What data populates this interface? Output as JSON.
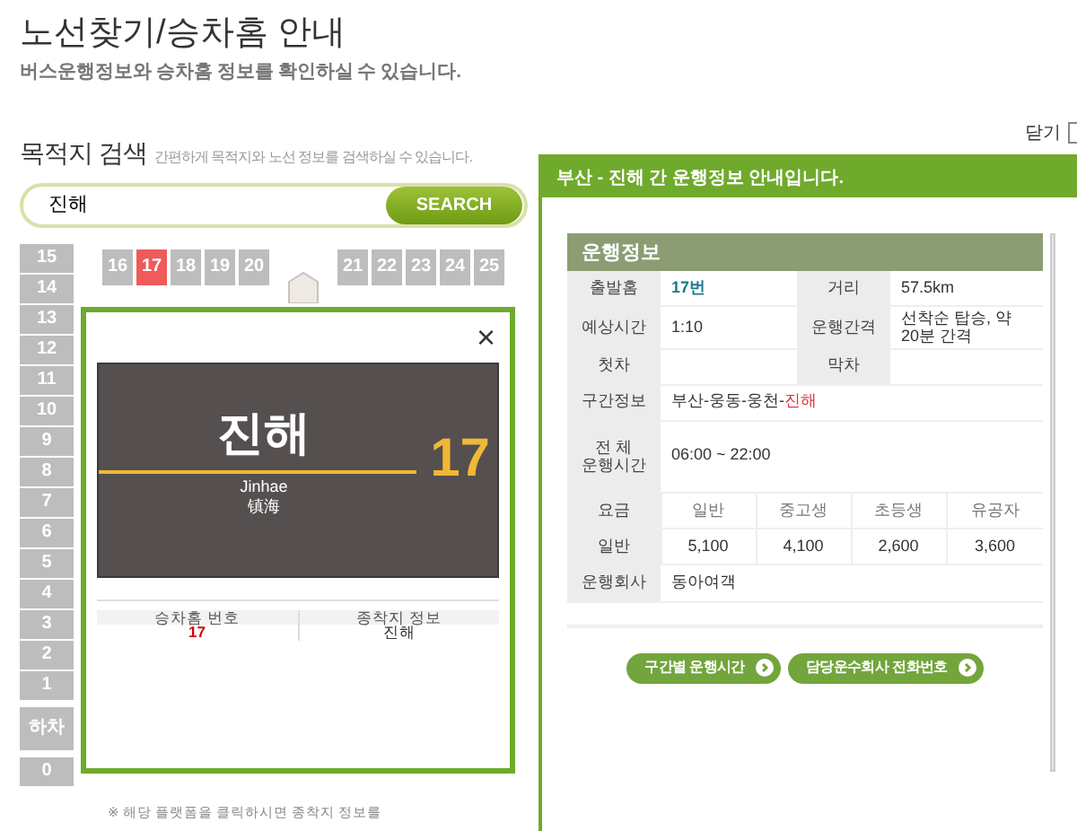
{
  "page_title": "노선찾기/승차홈 안내",
  "page_subtitle": "버스운행정보와 승차홈 정보를 확인하실 수 있습니다.",
  "search": {
    "title": "목적지 검색",
    "hint": "간편하게 목적지와 노선 정보를 검색하실 수 있습니다.",
    "value": "진해",
    "button": "SEARCH"
  },
  "close_label": "닫기",
  "platforms_top": [
    {
      "label": "16",
      "selected": false
    },
    {
      "label": "17",
      "selected": true
    },
    {
      "label": "18",
      "selected": false
    },
    {
      "label": "19",
      "selected": false
    },
    {
      "label": "20",
      "selected": false
    },
    {
      "label": "21",
      "selected": false
    },
    {
      "label": "22",
      "selected": false
    },
    {
      "label": "23",
      "selected": false
    },
    {
      "label": "24",
      "selected": false
    },
    {
      "label": "25",
      "selected": false
    }
  ],
  "platforms_side": [
    {
      "label": "15",
      "kind": "platform"
    },
    {
      "label": "14",
      "kind": "platform"
    },
    {
      "label": "13",
      "kind": "platform"
    },
    {
      "label": "12",
      "kind": "platform"
    },
    {
      "label": "11",
      "kind": "platform"
    },
    {
      "label": "10",
      "kind": "platform"
    },
    {
      "label": "9",
      "kind": "platform"
    },
    {
      "label": "8",
      "kind": "platform"
    },
    {
      "label": "7",
      "kind": "platform"
    },
    {
      "label": "6",
      "kind": "platform"
    },
    {
      "label": "5",
      "kind": "platform"
    },
    {
      "label": "4",
      "kind": "platform"
    },
    {
      "label": "3",
      "kind": "platform"
    },
    {
      "label": "2",
      "kind": "platform"
    },
    {
      "label": "1",
      "kind": "platform"
    },
    {
      "label": "하차",
      "kind": "exit"
    },
    {
      "label": "0",
      "kind": "platform"
    }
  ],
  "popup": {
    "close": "×",
    "destination": "진해",
    "romanized": "Jinhae",
    "chinese": "镇海",
    "platform_number": "17",
    "info_headers": [
      "승차홈 번호",
      "종착지 정보"
    ],
    "info_values": [
      "17",
      "진해"
    ]
  },
  "footnote": "※ 해당 플랫폼을 클릭하시면 종착지 정보를",
  "route_panel": {
    "header": "부산 - 진해 간 운행정보 안내입니다.",
    "section_title": "운행정보",
    "rows": [
      {
        "label": "출발홈",
        "value": "17번",
        "label2": "거리",
        "value2": "57.5km"
      },
      {
        "label": "예상시간",
        "value": "1:10",
        "label2": "운행간격",
        "value2": "선착순 탑승, 약 20분 간격"
      },
      {
        "label": "첫차",
        "value": "",
        "label2": "막차",
        "value2": ""
      }
    ],
    "route_label": "구간정보",
    "route": [
      {
        "text": "부산-웅동-웅천-",
        "highlight": false
      },
      {
        "text": "진해",
        "highlight": true
      }
    ],
    "hours_label": [
      "전 체",
      "운행시간"
    ],
    "hours": "06:00 ~ 22:00",
    "fare_header": [
      "요금",
      "일반",
      "중고생",
      "초등생",
      "유공자"
    ],
    "fare_row": [
      "일반",
      "5,100",
      "4,100",
      "2,600",
      "3,600"
    ],
    "company_label": "운행회사",
    "company": "동아여객",
    "buttons": [
      "구간별 운행시간",
      "담당운수회사 전화번호"
    ]
  }
}
